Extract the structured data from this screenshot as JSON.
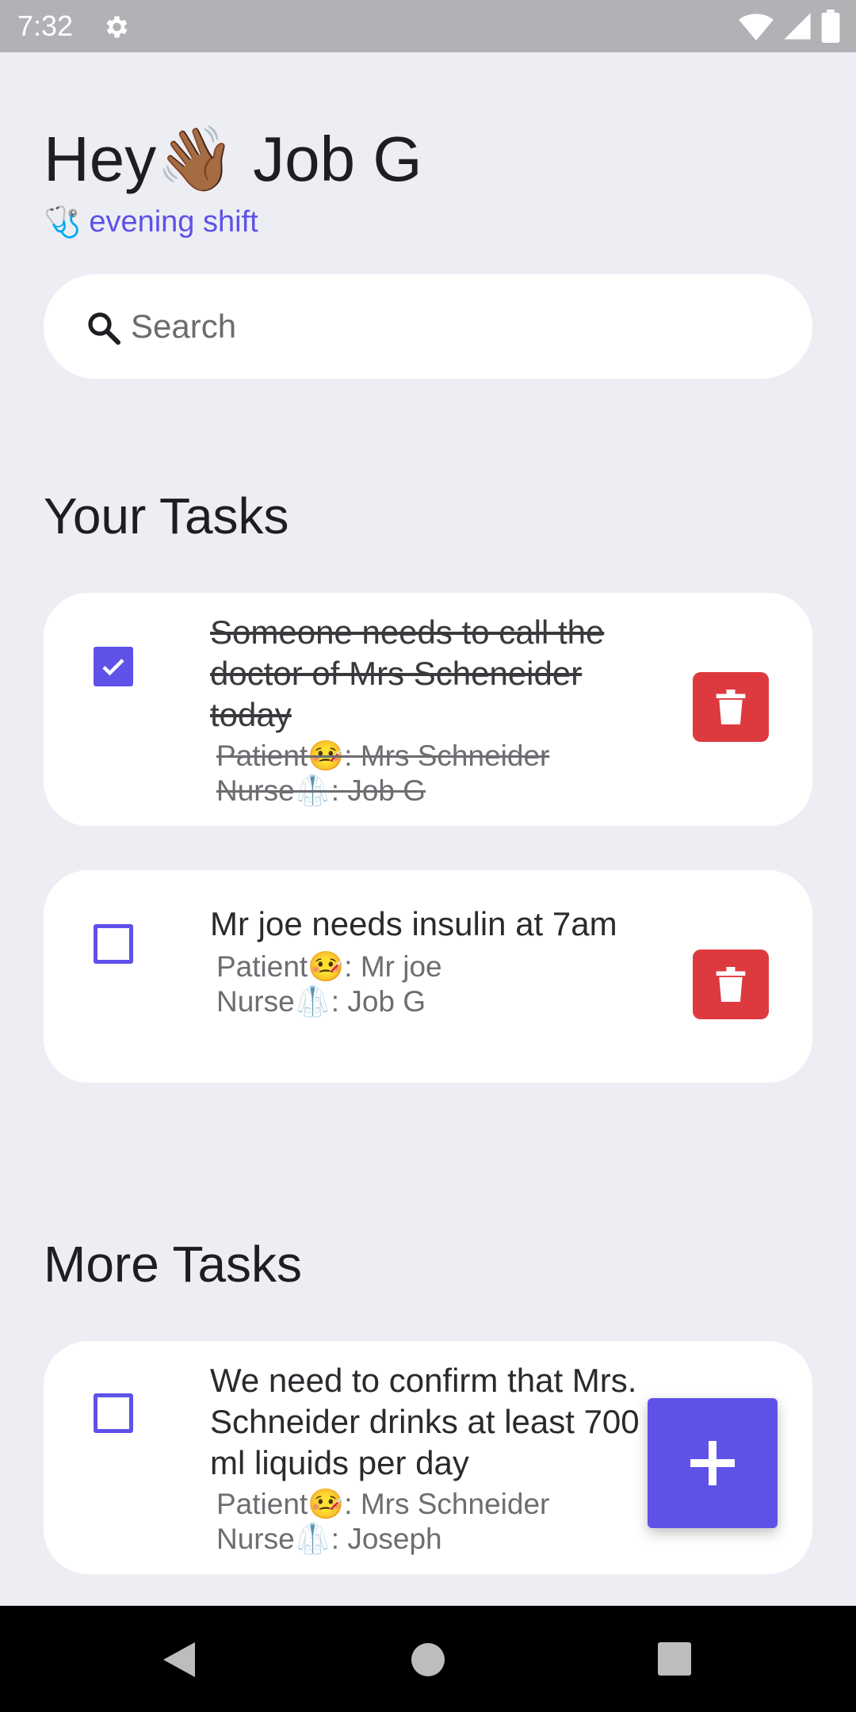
{
  "status_bar": {
    "time": "7:32",
    "icons": [
      "gear-icon",
      "wifi-icon",
      "signal-icon",
      "battery-icon"
    ]
  },
  "header": {
    "greeting_prefix": "Hey",
    "greeting_emoji": "👋🏾",
    "user_name": "Job G",
    "shift_emoji": "🩺",
    "shift": "evening shift"
  },
  "search": {
    "placeholder": "Search",
    "value": ""
  },
  "sections": {
    "your_tasks_title": "Your Tasks",
    "more_tasks_title": "More Tasks"
  },
  "your_tasks": [
    {
      "title": "Someone needs to call the doctor of Mrs Scheneider today",
      "patient": "Patient🤒: Mrs Schneider",
      "nurse": "Nurse🥼: Job G",
      "done": true
    },
    {
      "title": "Mr joe needs insulin at 7am",
      "patient": "Patient🤒: Mr joe",
      "nurse": "Nurse🥼: Job G",
      "done": false
    }
  ],
  "more_tasks": [
    {
      "title": "We need to confirm that Mrs. Schneider drinks at least 700 ml liquids per day",
      "patient": "Patient🤒: Mrs Schneider",
      "nurse": "Nurse🥼: Joseph",
      "done": false
    }
  ],
  "colors": {
    "accent": "#5e52e8",
    "delete": "#dd3a3f",
    "background": "#edeef4"
  },
  "fab": {
    "icon": "plus-icon"
  },
  "nav": {
    "icons": [
      "back-icon",
      "home-icon",
      "recents-icon"
    ]
  }
}
